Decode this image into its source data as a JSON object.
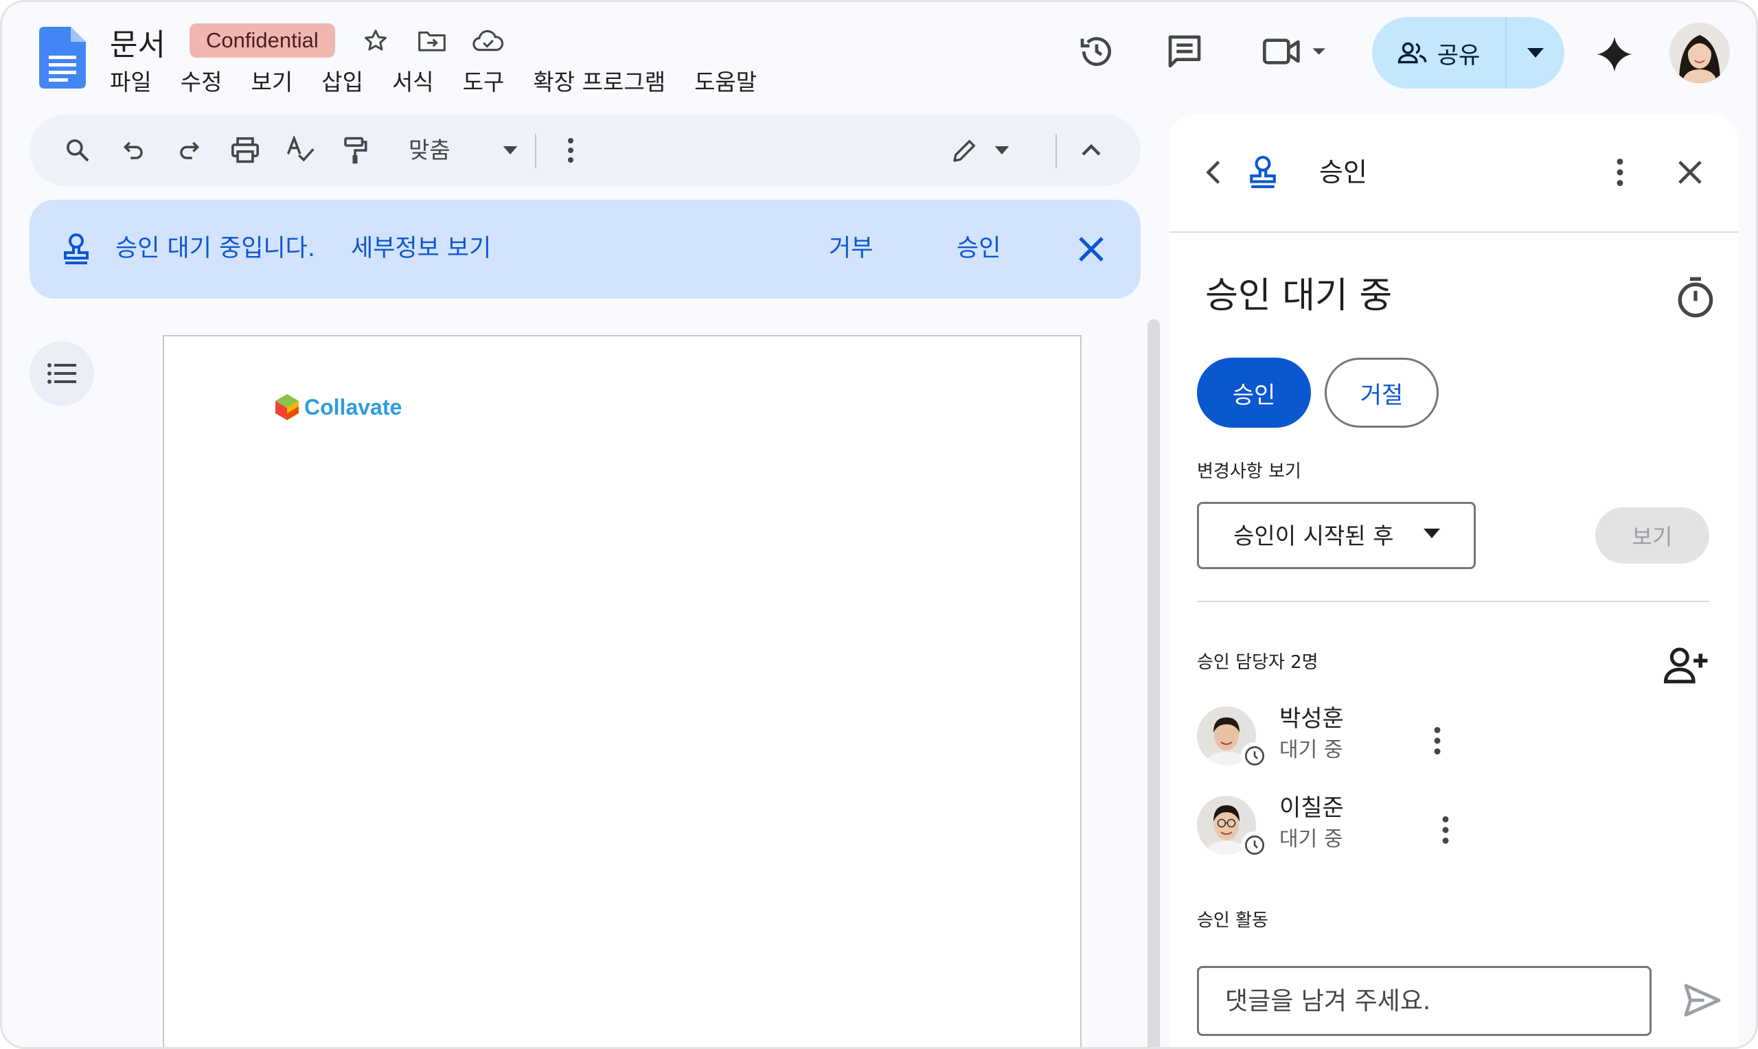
{
  "app": {
    "doc_title": "문서",
    "label_badge": "Confidential",
    "menu": [
      "파일",
      "수정",
      "보기",
      "삽입",
      "서식",
      "도구",
      "확장 프로그램",
      "도움말"
    ],
    "share_label": "공유"
  },
  "toolbar": {
    "zoom_label": "맞춤"
  },
  "banner": {
    "message": "승인 대기 중입니다.",
    "details_link": "세부정보 보기",
    "reject_label": "거부",
    "approve_label": "승인"
  },
  "document": {
    "logo_text": "Collavate"
  },
  "panel": {
    "title": "승인",
    "status_title": "승인 대기 중",
    "approve_button": "승인",
    "reject_button": "거절",
    "view_changes_label": "변경사항 보기",
    "changes_select_value": "승인이 시작된 후",
    "view_button": "보기",
    "approvers_label": "승인 담당자 2명",
    "approvers": [
      {
        "name": "박성훈",
        "status": "대기 중"
      },
      {
        "name": "이칠준",
        "status": "대기 중"
      }
    ],
    "activity_label": "승인 활동",
    "comment_placeholder": "댓글을 남겨 주세요."
  },
  "colors": {
    "accent": "#0b57d0",
    "banner_bg": "#d3e3fd",
    "share_bg": "#c2e7ff",
    "badge_bg": "#f0b6b0"
  }
}
